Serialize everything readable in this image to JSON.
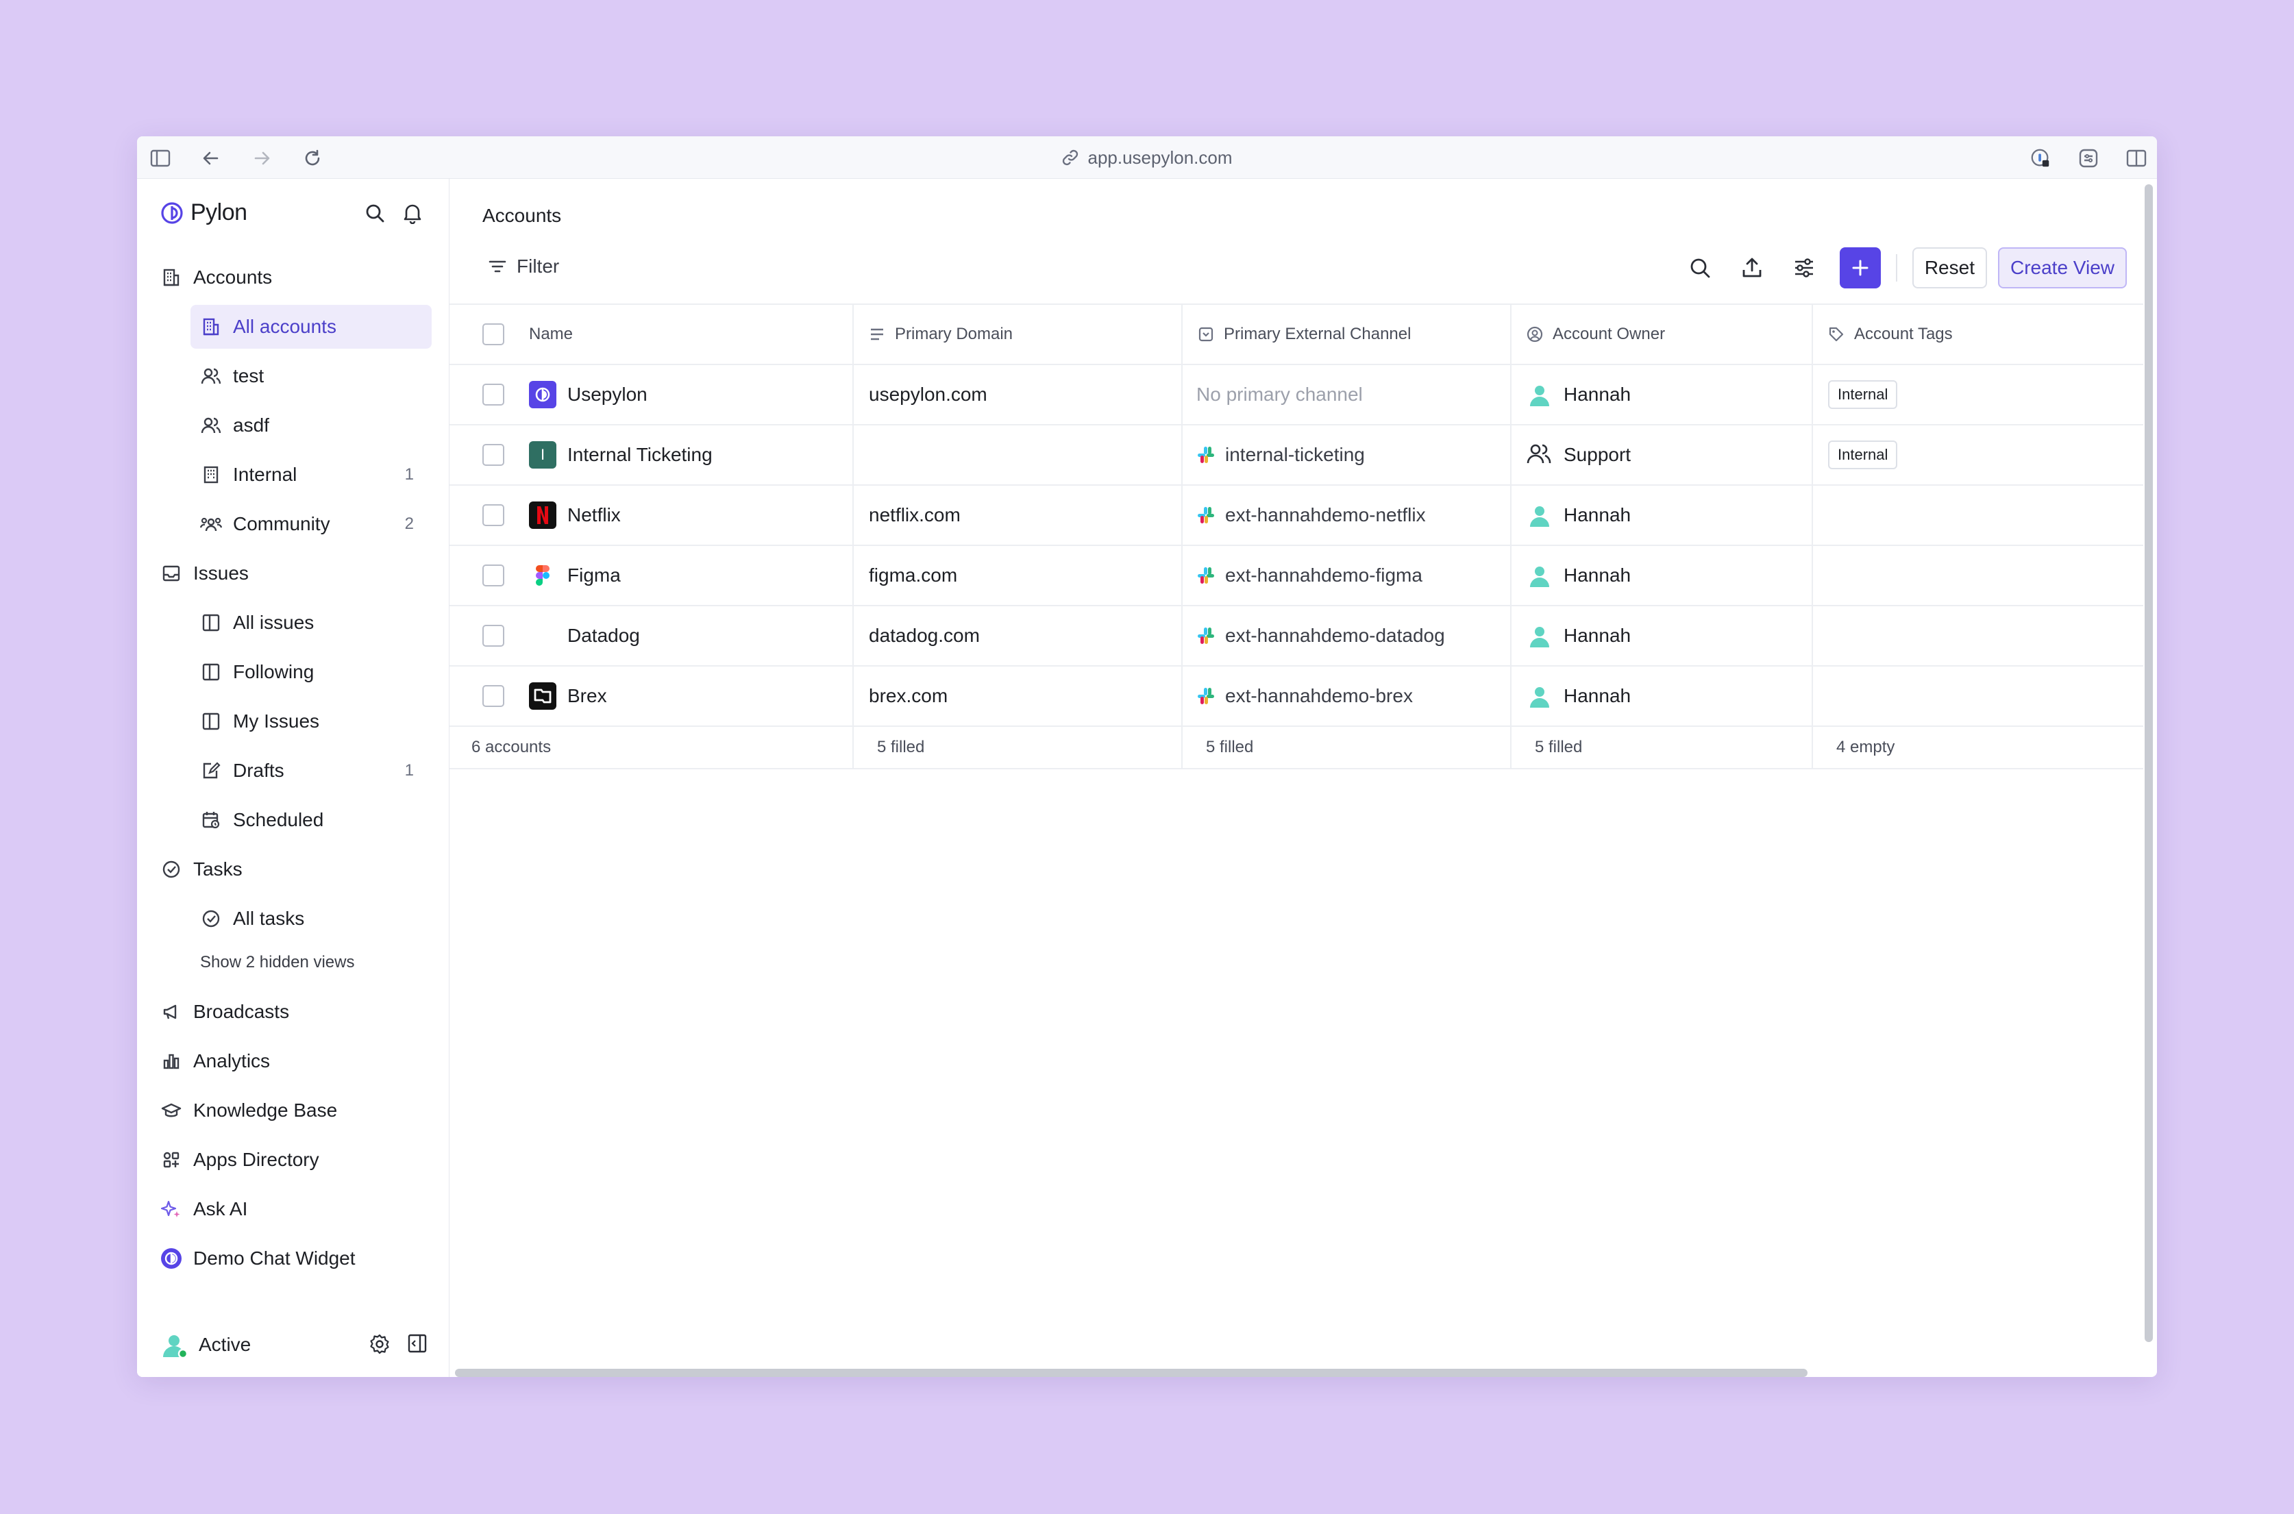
{
  "browser": {
    "url": "app.usepylon.com"
  },
  "brand": {
    "name": "Pylon"
  },
  "sidebar": {
    "sections": [
      {
        "label": "Accounts",
        "icon": "building-icon"
      },
      {
        "label": "Issues",
        "icon": "inbox-icon"
      },
      {
        "label": "Tasks",
        "icon": "check-circle-icon"
      },
      {
        "label": "Broadcasts",
        "icon": "megaphone-icon"
      },
      {
        "label": "Analytics",
        "icon": "bar-chart-icon"
      },
      {
        "label": "Knowledge Base",
        "icon": "graduation-cap-icon"
      },
      {
        "label": "Apps Directory",
        "icon": "apps-icon"
      },
      {
        "label": "Ask AI",
        "icon": "sparkles-icon"
      },
      {
        "label": "Demo Chat Widget",
        "icon": "chat-widget-icon"
      }
    ],
    "accounts_items": [
      {
        "label": "All accounts",
        "count": ""
      },
      {
        "label": "test",
        "count": ""
      },
      {
        "label": "asdf",
        "count": ""
      },
      {
        "label": "Internal",
        "count": "1"
      },
      {
        "label": "Community",
        "count": "2"
      }
    ],
    "issues_items": [
      {
        "label": "All issues",
        "count": ""
      },
      {
        "label": "Following",
        "count": ""
      },
      {
        "label": "My Issues",
        "count": ""
      },
      {
        "label": "Drafts",
        "count": "1"
      },
      {
        "label": "Scheduled",
        "count": ""
      }
    ],
    "tasks_items": [
      {
        "label": "All tasks"
      }
    ],
    "show_hidden": "Show 2 hidden views",
    "footer_status": "Active"
  },
  "main": {
    "title": "Accounts",
    "filter_label": "Filter",
    "reset_label": "Reset",
    "create_view_label": "Create View",
    "columns": [
      "Name",
      "Primary Domain",
      "Primary External Channel",
      "Account Owner",
      "Account Tags"
    ],
    "rows": [
      {
        "name": "Usepylon",
        "domain": "usepylon.com",
        "channel": "No primary channel",
        "owner": "Hannah",
        "tag": "Internal"
      },
      {
        "name": "Internal Ticketing",
        "domain": "",
        "channel": "internal-ticketing",
        "owner": "Support",
        "tag": "Internal"
      },
      {
        "name": "Netflix",
        "domain": "netflix.com",
        "channel": "ext-hannahdemo-netflix",
        "owner": "Hannah",
        "tag": ""
      },
      {
        "name": "Figma",
        "domain": "figma.com",
        "channel": "ext-hannahdemo-figma",
        "owner": "Hannah",
        "tag": ""
      },
      {
        "name": "Datadog",
        "domain": "datadog.com",
        "channel": "ext-hannahdemo-datadog",
        "owner": "Hannah",
        "tag": ""
      },
      {
        "name": "Brex",
        "domain": "brex.com",
        "channel": "ext-hannahdemo-brex",
        "owner": "Hannah",
        "tag": ""
      }
    ],
    "summary": {
      "count": "6 accounts",
      "domain": "5 filled",
      "channel": "5 filled",
      "owner": "5 filled",
      "tags": "4 empty"
    }
  },
  "colors": {
    "background": "#dbcaf6",
    "accent": "#5744e6",
    "active_bg": "#eeebfb"
  }
}
